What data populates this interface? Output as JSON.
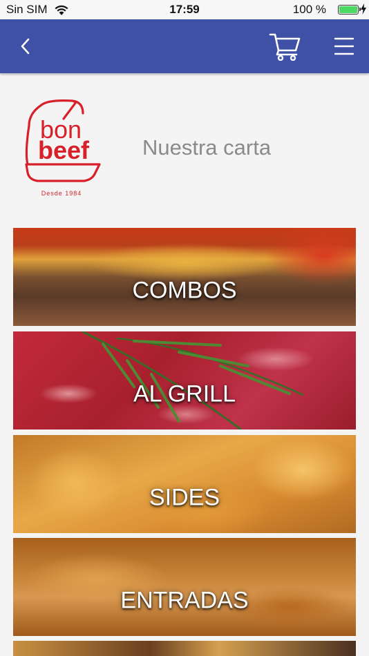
{
  "status_bar": {
    "carrier": "Sin SIM",
    "time": "17:59",
    "battery_percent": "100 %",
    "battery_level": 1.0
  },
  "nav": {
    "back_icon": "chevron-left-icon",
    "cart_icon": "cart-icon",
    "menu_icon": "hamburger-menu-icon",
    "color": "#3f51a7"
  },
  "logo": {
    "line1": "bon",
    "line2": "beef",
    "tagline": "Desde 1984",
    "color": "#d8202a"
  },
  "header": {
    "title": "Nuestra carta"
  },
  "categories": [
    {
      "label": "COMBOS"
    },
    {
      "label": "AL GRILL"
    },
    {
      "label": "SIDES"
    },
    {
      "label": "ENTRADAS"
    },
    {
      "label": ""
    }
  ]
}
